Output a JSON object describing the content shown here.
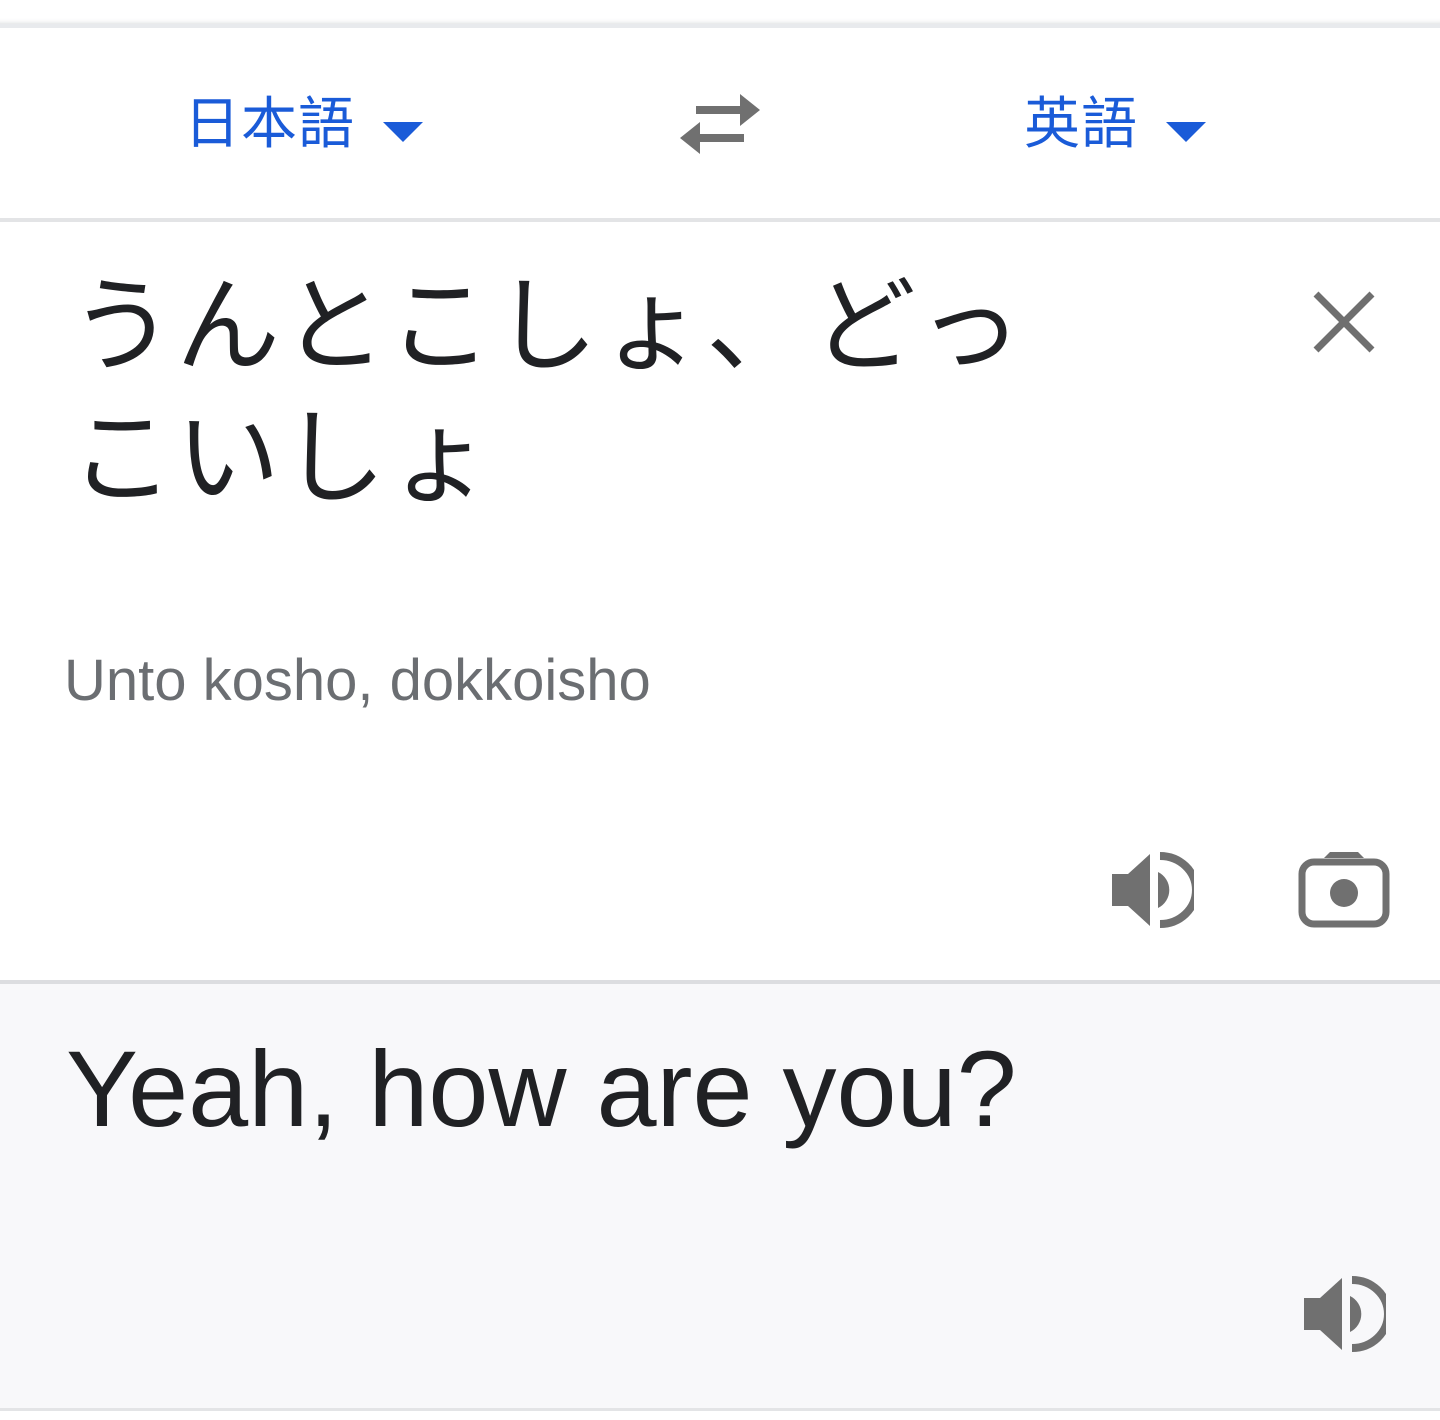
{
  "language_bar": {
    "source_language": "日本語",
    "target_language": "英語",
    "swap_icon": "swap-arrows-icon",
    "dropdown_icon": "caret-down-icon",
    "accent_color": "#1a5bd8"
  },
  "source": {
    "text": "うんとこしょ、どっこいしょ",
    "romanization": "Unto kosho, dokkoisho",
    "clear_icon": "close-icon",
    "speak_icon": "speaker-icon",
    "camera_icon": "camera-icon"
  },
  "result": {
    "text": "Yeah, how are you?",
    "speak_icon": "speaker-icon",
    "background_color": "#f8f8fa"
  }
}
